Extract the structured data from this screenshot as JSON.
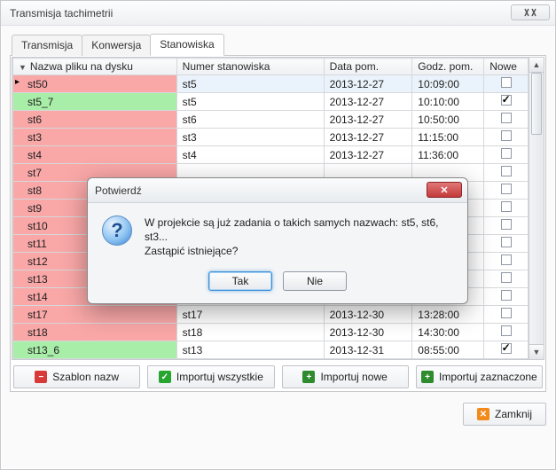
{
  "window": {
    "title": "Transmisja tachimetrii"
  },
  "tabs": [
    {
      "label": "Transmisja",
      "active": false
    },
    {
      "label": "Konwersja",
      "active": false
    },
    {
      "label": "Stanowiska",
      "active": true
    }
  ],
  "grid": {
    "columns": [
      {
        "label": "Nazwa pliku na dysku"
      },
      {
        "label": "Numer stanowiska"
      },
      {
        "label": "Data pom."
      },
      {
        "label": "Godz. pom."
      },
      {
        "label": "Nowe"
      }
    ],
    "rows": [
      {
        "file": "st50",
        "station": "st5",
        "date": "2013-12-27",
        "time": "10:09:00",
        "new": false,
        "color": "pink",
        "pointer": true,
        "selected": true
      },
      {
        "file": "st5_7",
        "station": "st5",
        "date": "2013-12-27",
        "time": "10:10:00",
        "new": true,
        "color": "green"
      },
      {
        "file": "st6",
        "station": "st6",
        "date": "2013-12-27",
        "time": "10:50:00",
        "new": false,
        "color": "pink"
      },
      {
        "file": "st3",
        "station": "st3",
        "date": "2013-12-27",
        "time": "11:15:00",
        "new": false,
        "color": "pink"
      },
      {
        "file": "st4",
        "station": "st4",
        "date": "2013-12-27",
        "time": "11:36:00",
        "new": false,
        "color": "pink"
      },
      {
        "file": "st7",
        "station": "",
        "date": "",
        "time": "",
        "new": false,
        "color": "pink"
      },
      {
        "file": "st8",
        "station": "",
        "date": "",
        "time": "",
        "new": false,
        "color": "pink"
      },
      {
        "file": "st9",
        "station": "",
        "date": "",
        "time": "",
        "new": false,
        "color": "pink"
      },
      {
        "file": "st10",
        "station": "",
        "date": "",
        "time": "",
        "new": false,
        "color": "pink"
      },
      {
        "file": "st11",
        "station": "",
        "date": "",
        "time": "",
        "new": false,
        "color": "pink"
      },
      {
        "file": "st12",
        "station": "",
        "date": "",
        "time": "",
        "new": false,
        "color": "pink"
      },
      {
        "file": "st13",
        "station": "",
        "date": "",
        "time": "",
        "new": false,
        "color": "pink"
      },
      {
        "file": "st14",
        "station": "",
        "date": "",
        "time": "",
        "new": false,
        "color": "pink"
      },
      {
        "file": "st17",
        "station": "st17",
        "date": "2013-12-30",
        "time": "13:28:00",
        "new": false,
        "color": "pink"
      },
      {
        "file": "st18",
        "station": "st18",
        "date": "2013-12-30",
        "time": "14:30:00",
        "new": false,
        "color": "pink"
      },
      {
        "file": "st13_6",
        "station": "st13",
        "date": "2013-12-31",
        "time": "08:55:00",
        "new": true,
        "color": "green"
      }
    ]
  },
  "toolbar": {
    "template_label": "Szablon nazw",
    "import_all_label": "Importuj wszystkie",
    "import_new_label": "Importuj nowe",
    "import_selected_label": "Importuj zaznaczone"
  },
  "footer": {
    "close_label": "Zamknij"
  },
  "dialog": {
    "title": "Potwierdź",
    "message_line1": "W projekcie są już zadania o takich samych nazwach: st5, st6, st3...",
    "message_line2": "Zastąpić istniejące?",
    "yes_label": "Tak",
    "no_label": "Nie"
  }
}
